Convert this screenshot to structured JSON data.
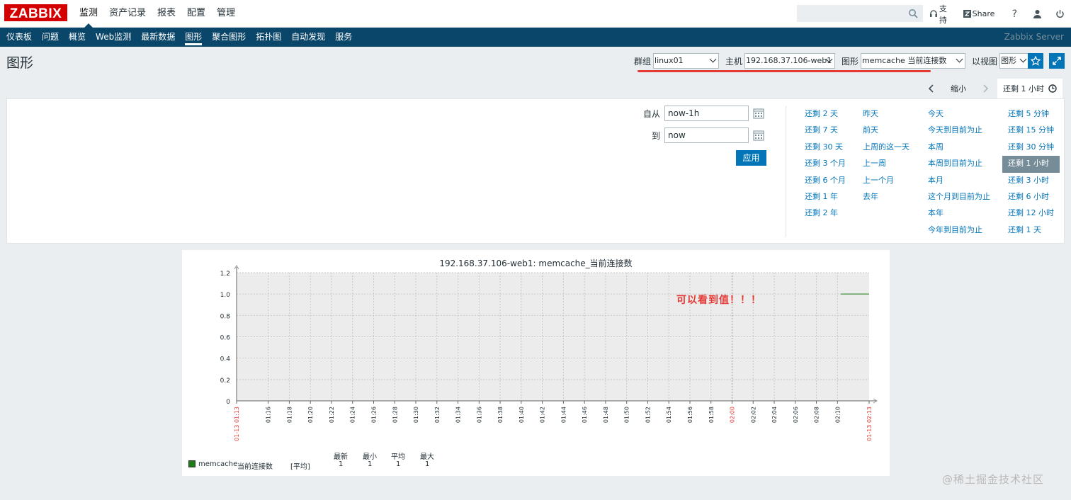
{
  "logo": "ZABBIX",
  "main_menu": [
    {
      "label": "监测",
      "active": true
    },
    {
      "label": "资产记录",
      "active": false
    },
    {
      "label": "报表",
      "active": false
    },
    {
      "label": "配置",
      "active": false
    },
    {
      "label": "管理",
      "active": false
    }
  ],
  "search": {
    "value": "",
    "placeholder": ""
  },
  "top_links": {
    "support": "支持",
    "share": "Share"
  },
  "sub_menu": [
    {
      "label": "仪表板",
      "active": false
    },
    {
      "label": "问题",
      "active": false
    },
    {
      "label": "概览",
      "active": false
    },
    {
      "label": "Web监测",
      "active": false
    },
    {
      "label": "最新数据",
      "active": false
    },
    {
      "label": "图形",
      "active": true
    },
    {
      "label": "聚合图形",
      "active": false
    },
    {
      "label": "拓扑图",
      "active": false
    },
    {
      "label": "自动发现",
      "active": false
    },
    {
      "label": "服务",
      "active": false
    }
  ],
  "server_name": "Zabbix Server",
  "page_title": "图形",
  "filters": {
    "group_label": "群组",
    "group_value": "linux01",
    "host_label": "主机",
    "host_value": "192.168.37.106-web1",
    "graph_label": "图形",
    "graph_value": "memcache 当前连接数",
    "view_label": "以视图",
    "view_value": "图形"
  },
  "time_tabs": {
    "zoom_out": "缩小",
    "active": "还剩 1 小时"
  },
  "time_filter": {
    "from_label": "自从",
    "from_value": "now-1h",
    "to_label": "到",
    "to_value": "now",
    "apply": "应用"
  },
  "quick_ranges": [
    [
      "还剩 2 天",
      "还剩 7 天",
      "还剩 30 天",
      "还剩 3 个月",
      "还剩 6 个月",
      "还剩 1 年",
      "还剩 2 年"
    ],
    [
      "昨天",
      "前天",
      "上周的这一天",
      "上一周",
      "上一个月",
      "去年"
    ],
    [
      "今天",
      "今天到目前为止",
      "本周",
      "本周到目前为止",
      "本月",
      "这个月到目前为止",
      "本年",
      "今年到目前为止"
    ],
    [
      "还剩 5 分钟",
      "还剩 15 分钟",
      "还剩 30 分钟",
      "还剩 1 小时",
      "还剩 3 小时",
      "还剩 6 小时",
      "还剩 12 小时",
      "还剩 1 天"
    ]
  ],
  "quick_selected": "还剩 1 小时",
  "annotation": "可以看到值！！！",
  "watermark": "@稀土掘金技术社区",
  "chart_data": {
    "type": "line",
    "title": "192.168.37.106-web1: memcache_当前连接数",
    "ylim": [
      0,
      1.2
    ],
    "y_ticks": [
      "0",
      "0.2",
      "0.4",
      "0.6",
      "0.8",
      "1.0",
      "1.2"
    ],
    "x_ticks": [
      "01-13 01:13",
      "01:16",
      "01:18",
      "01:20",
      "01:22",
      "01:24",
      "01:26",
      "01:28",
      "01:30",
      "01:32",
      "01:34",
      "01:36",
      "01:38",
      "01:40",
      "01:42",
      "01:44",
      "01:46",
      "01:48",
      "01:50",
      "01:52",
      "01:54",
      "01:56",
      "01:58",
      "02:00",
      "02:02",
      "02:04",
      "02:06",
      "02:08",
      "02:10",
      "01-13 02:13"
    ],
    "x_tick_minutes": [
      0,
      3,
      5,
      7,
      9,
      11,
      13,
      15,
      17,
      19,
      21,
      23,
      25,
      27,
      29,
      31,
      33,
      35,
      37,
      39,
      41,
      43,
      45,
      47,
      49,
      51,
      53,
      55,
      57,
      60
    ],
    "red_ticks": [
      "01-13 01:13",
      "02:00",
      "01-13 02:13"
    ],
    "grid": true,
    "series": [
      {
        "name": "memcache 当前连接数",
        "color": "#1a7c11",
        "x_minutes": [
          57.3,
          60
        ],
        "values": [
          1,
          1
        ]
      }
    ],
    "legend": {
      "item": "memcache",
      "label": "当前连接数",
      "func": "[平均]",
      "headers": [
        "最新",
        "最小",
        "平均",
        "最大"
      ],
      "values": [
        "1",
        "1",
        "1",
        "1"
      ]
    }
  }
}
